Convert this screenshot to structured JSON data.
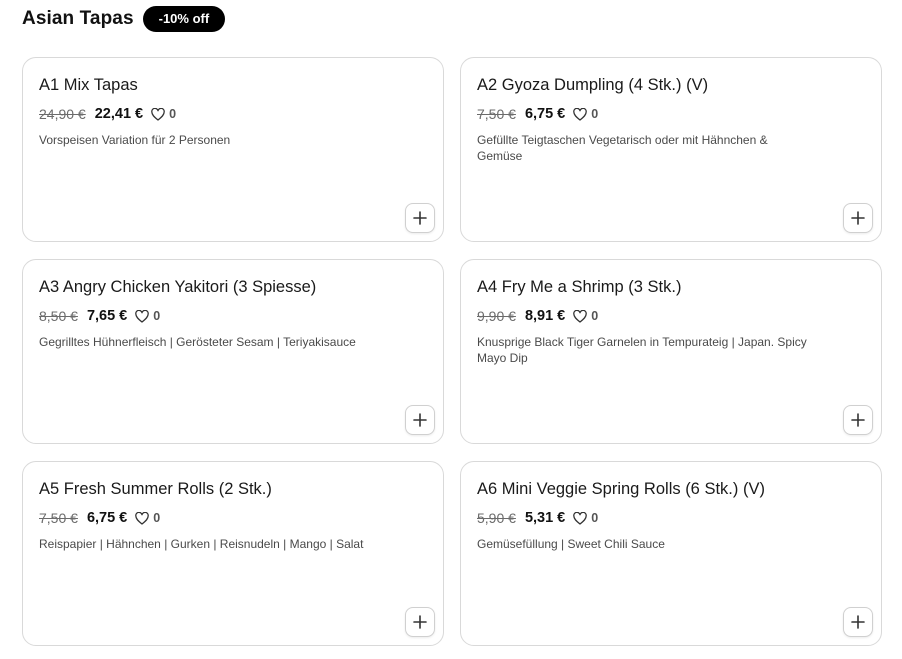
{
  "section": {
    "title": "Asian Tapas",
    "badge": "-10% off"
  },
  "items": [
    {
      "name": "A1 Mix Tapas",
      "old_price": "24,90 €",
      "price": "22,41 €",
      "likes": "0",
      "description": "Vorspeisen Variation für 2 Personen"
    },
    {
      "name": "A2 Gyoza Dumpling (4 Stk.) (V)",
      "old_price": "7,50 €",
      "price": "6,75 €",
      "likes": "0",
      "description": "Gefüllte Teigtaschen Vegetarisch oder mit Hähnchen & Gemüse"
    },
    {
      "name": "A3 Angry Chicken Yakitori (3 Spiesse)",
      "old_price": "8,50 €",
      "price": "7,65 €",
      "likes": "0",
      "description": "Gegrilltes Hühnerfleisch | Gerösteter Sesam | Teriyakisauce"
    },
    {
      "name": "A4 Fry Me a Shrimp (3 Stk.)",
      "old_price": "9,90 €",
      "price": "8,91 €",
      "likes": "0",
      "description": "Knusprige Black Tiger Garnelen in Tempurateig | Japan. Spicy Mayo Dip"
    },
    {
      "name": "A5 Fresh Summer Rolls (2 Stk.)",
      "old_price": "7,50 €",
      "price": "6,75 €",
      "likes": "0",
      "description": "Reispapier | Hähnchen | Gurken | Reisnudeln | Mango | Salat"
    },
    {
      "name": "A6 Mini Veggie Spring Rolls (6 Stk.) (V)",
      "old_price": "5,90 €",
      "price": "5,31 €",
      "likes": "0",
      "description": "Gemüsefüllung | Sweet Chili Sauce"
    }
  ],
  "icons": {
    "like": "heart-icon",
    "add": "plus-icon"
  }
}
